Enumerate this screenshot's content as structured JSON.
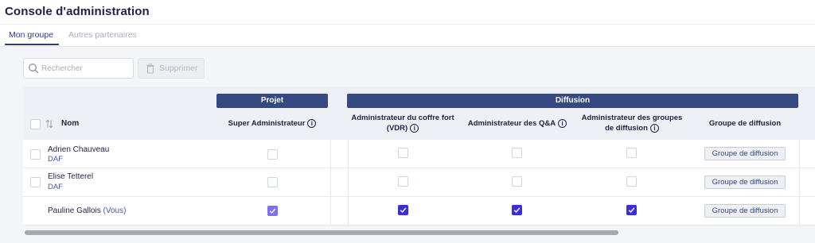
{
  "app": {
    "title": "Console d'administration"
  },
  "tabs": [
    {
      "label": "Mon groupe",
      "active": true
    },
    {
      "label": "Autres partenaires",
      "active": false
    }
  ],
  "toolbar": {
    "search_placeholder": "Rechercher",
    "delete_label": "Supprimer"
  },
  "table": {
    "groups": {
      "projet": "Projet",
      "diffusion": "Diffusion"
    },
    "columns": {
      "nom": "Nom",
      "super_admin": "Super Administrateur",
      "admin_vdr_line1": "Administrateur du coffre fort",
      "admin_vdr_line2": "(VDR)",
      "admin_qa": "Administrateur des Q&A",
      "admin_groupes_line1": "Administrateur des groupes",
      "admin_groupes_line2": "de diffusion",
      "groupe_diffusion": "Groupe de diffusion"
    },
    "rows": [
      {
        "name": "Adrien Chauveau",
        "role": "DAF",
        "vous": "",
        "super_admin": false,
        "admin_vdr": false,
        "admin_qa": false,
        "admin_groupes": false,
        "groupe_label": "Groupe de diffusion"
      },
      {
        "name": "Elise Tetterel",
        "role": "DAF",
        "vous": "",
        "super_admin": false,
        "admin_vdr": false,
        "admin_qa": false,
        "admin_groupes": false,
        "groupe_label": "Groupe de diffusion"
      },
      {
        "name": "Pauline Gallois",
        "role": "",
        "vous": "(Vous)",
        "super_admin": true,
        "admin_vdr": true,
        "admin_qa": true,
        "admin_groupes": true,
        "groupe_label": "Groupe de diffusion"
      }
    ]
  },
  "colors": {
    "primary": "#34497f",
    "checkbox_checked": "#3a2fd6",
    "title": "#1e2147"
  },
  "icons": {
    "search": "search-icon",
    "delete": "trash-icon",
    "sort": "sort-icon",
    "info": "info-icon"
  }
}
